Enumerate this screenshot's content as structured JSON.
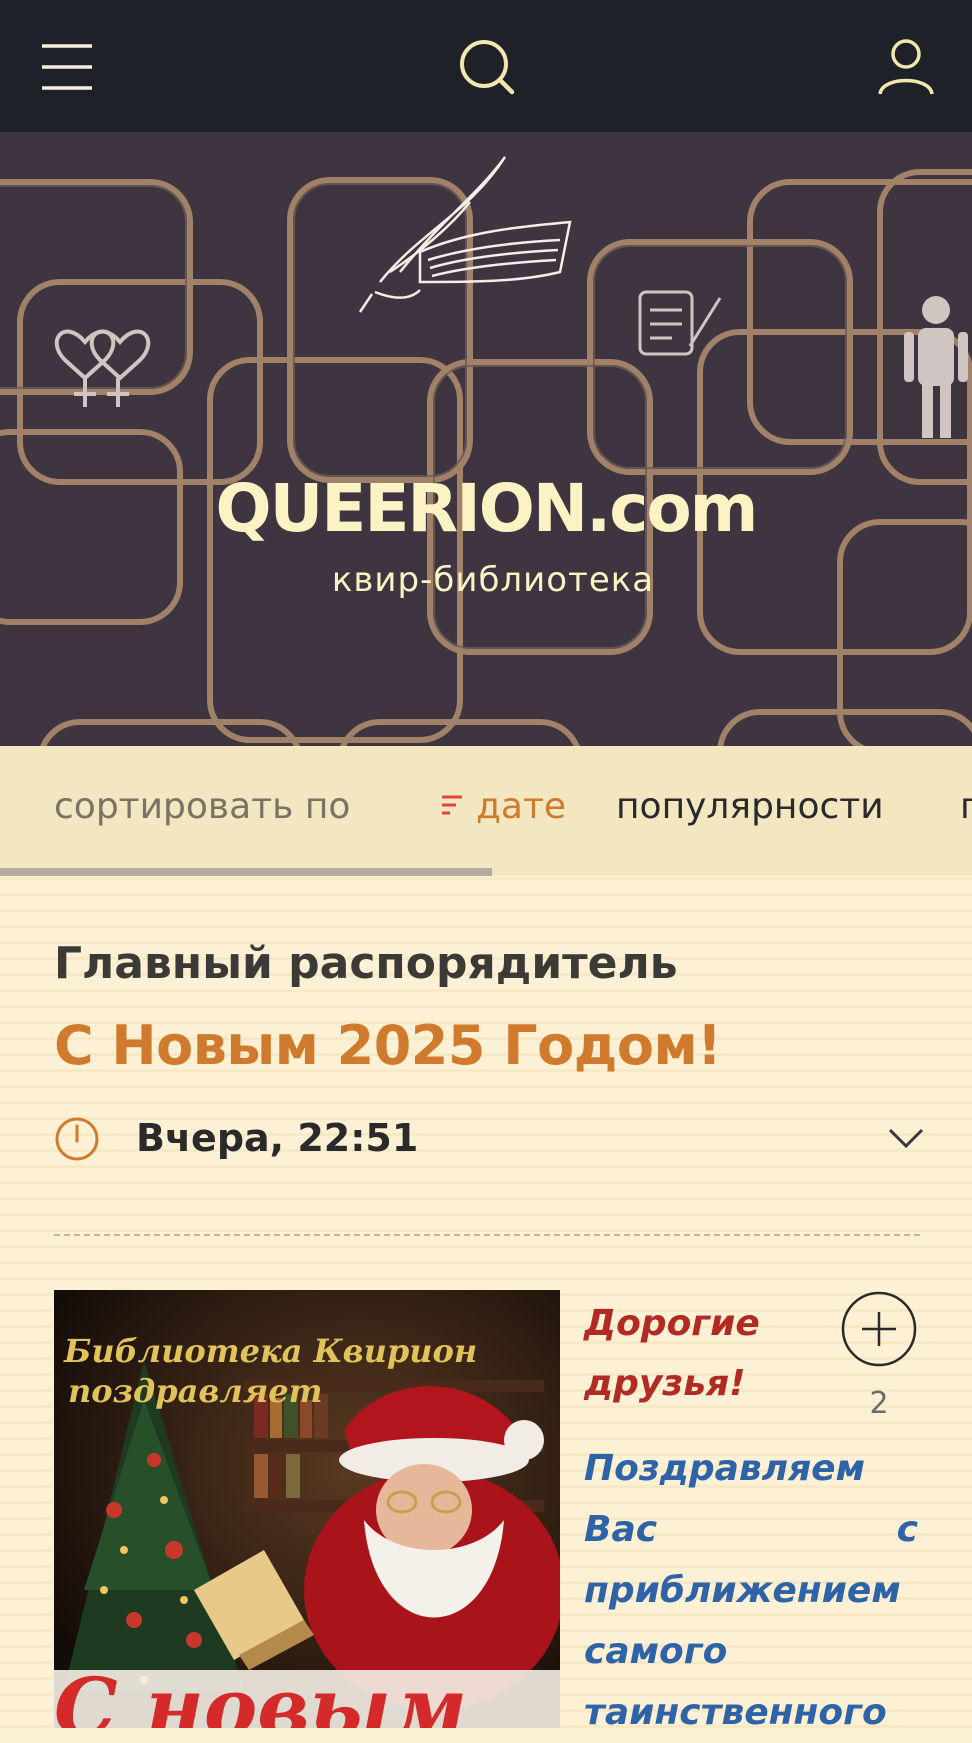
{
  "header": {
    "icons": [
      "menu-icon",
      "search-icon",
      "user-icon"
    ]
  },
  "hero": {
    "title": "QUEERION.com",
    "subtitle": "квир-библиотека"
  },
  "sort": {
    "label": "сортировать по",
    "options": [
      "дате",
      "популярности",
      "п"
    ],
    "active": "дате"
  },
  "post": {
    "author": "Главный распорядитель",
    "title": "С Новым 2025 Годом!",
    "date": "Вчера, 22:51",
    "image_caption_lines": [
      "Библиотека Квирион",
      "поздравляет"
    ],
    "image_big_text": "С новым",
    "greeting": "Дорогие друзья!",
    "body": "Поздравляем Вас с приближением самого таинственного",
    "plus_count": "2"
  },
  "colors": {
    "topbar": "#1e2228",
    "hero_bg": "#3e3540",
    "accent_orange": "#cf7a2c",
    "greeting_red": "#b12a23",
    "body_blue": "#2e63a8",
    "cream": "#fbf0d2"
  }
}
